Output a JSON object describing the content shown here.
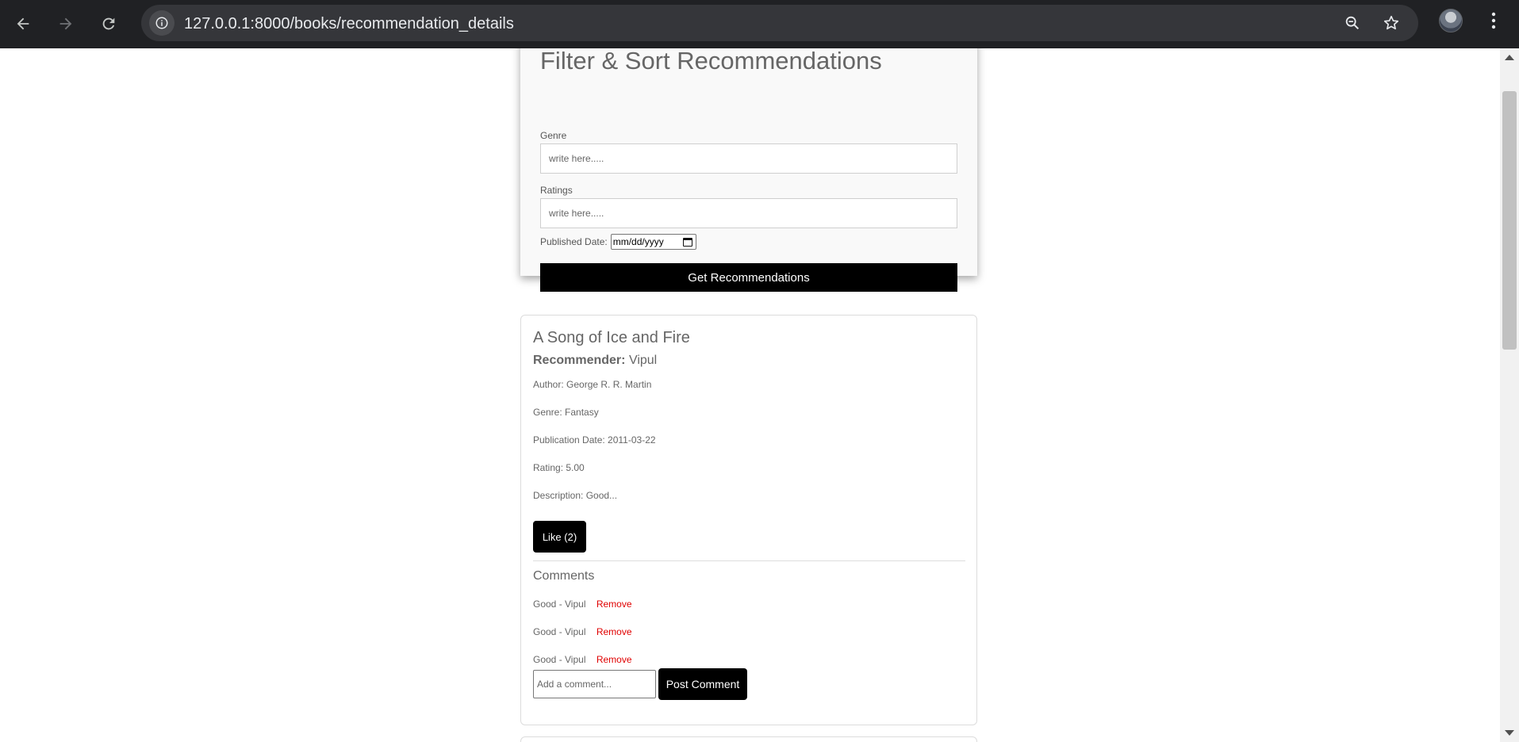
{
  "browser": {
    "url": "127.0.0.1:8000/books/recommendation_details",
    "icons": {
      "back": "back-arrow-icon",
      "forward": "forward-arrow-icon",
      "reload": "reload-icon",
      "site_info": "info-icon",
      "zoom": "zoom-icon",
      "bookmark": "star-icon",
      "profile": "avatar",
      "menu": "menu-dots-icon"
    }
  },
  "filter": {
    "title": "Filter & Sort Recommendations",
    "genre_label": "Genre",
    "genre_placeholder": "write here.....",
    "ratings_label": "Ratings",
    "ratings_placeholder": "write here.....",
    "date_label": "Published Date:",
    "date_value": "mm/dd/yyyy",
    "submit_label": "Get Recommendations"
  },
  "recommendation": {
    "title": "A Song of Ice and Fire",
    "recommender_label": "Recommender:",
    "recommender_name": "Vipul",
    "author": "Author: George R. R. Martin",
    "genre": "Genre: Fantasy",
    "publication_date": "Publication Date: 2011-03-22",
    "rating": "Rating: 5.00",
    "description": "Description: Good...",
    "like_label": "Like (2)",
    "comments_heading": "Comments",
    "comments": [
      {
        "text": "Good - Vipul",
        "remove_label": "Remove"
      },
      {
        "text": "Good - Vipul",
        "remove_label": "Remove"
      },
      {
        "text": "Good - Vipul",
        "remove_label": "Remove"
      }
    ],
    "comment_placeholder": "Add a comment...",
    "post_label": "Post Comment"
  },
  "colors": {
    "chrome_bg": "#202124",
    "omnibox_bg": "#35363a",
    "button_bg": "#000000",
    "remove_link": "#e00000",
    "text_muted": "#666666"
  }
}
